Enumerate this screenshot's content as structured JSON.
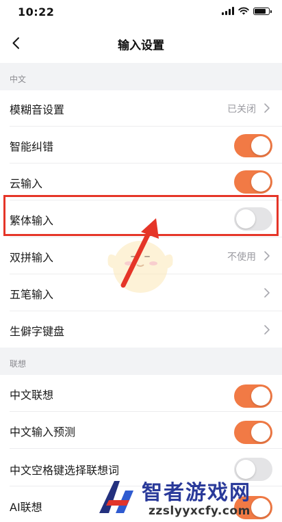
{
  "status_bar": {
    "time": "10:22"
  },
  "nav": {
    "title": "输入设置"
  },
  "sections": [
    {
      "header": "中文",
      "rows": [
        {
          "label": "模糊音设置",
          "value": "已关闭"
        },
        {
          "label": "智能纠错",
          "toggle": "on"
        },
        {
          "label": "云输入",
          "toggle": "on"
        },
        {
          "label": "繁体输入",
          "toggle": "off"
        },
        {
          "label": "双拼输入",
          "value": "不使用"
        },
        {
          "label": "五笔输入"
        },
        {
          "label": "生僻字键盘"
        }
      ]
    },
    {
      "header": "联想",
      "rows": [
        {
          "label": "中文联想",
          "toggle": "on"
        },
        {
          "label": "中文输入预测",
          "toggle": "on"
        },
        {
          "label": "中文空格键选择联想词",
          "toggle": "off"
        },
        {
          "label": "AI联想",
          "toggle": "on"
        }
      ]
    }
  ],
  "watermark": {
    "name": "智者游戏网",
    "url": "zzslyyxcfy.com"
  },
  "colors": {
    "accent": "#f17a45",
    "highlight": "#e53528",
    "toggle_off": "#e4e4e6"
  },
  "icons": [
    "back-chevron-icon",
    "chevron-right-icon",
    "signal-icon",
    "wifi-icon",
    "battery-icon"
  ]
}
